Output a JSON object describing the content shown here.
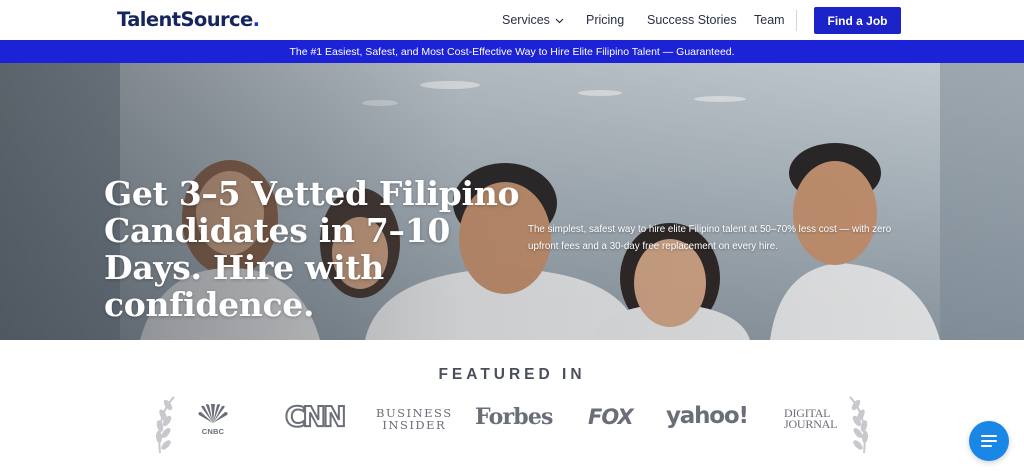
{
  "header": {
    "logo_text": "TalentSource",
    "logo_dot": ".",
    "nav": [
      {
        "label": "Services",
        "has_dropdown": true
      },
      {
        "label": "Pricing"
      },
      {
        "label": "Success Stories"
      },
      {
        "label": "Team"
      }
    ],
    "cta_label": "Find a Job"
  },
  "banner": {
    "text": "The #1 Easiest, Safest, and Most Cost-Effective Way to Hire Elite Filipino Talent — Guaranteed."
  },
  "hero": {
    "title": "Get 3–5 Vetted Filipino Candidates in 7–10 Days. Hire with confidence.",
    "subtitle": "The simplest, safest way to hire elite Filipino talent at 50–70% less cost — with zero upfront fees and a 30-day free replacement on every hire."
  },
  "featured": {
    "heading": "FEATURED IN",
    "logos": {
      "nbc": "CNBC",
      "cnn": "CNN",
      "business_insider_line1": "BUSINESS",
      "business_insider_line2": "INSIDER",
      "forbes": "Forbes",
      "fox": "FOX",
      "yahoo": "yahoo!",
      "digital_journal_line1": "DIGITAL",
      "digital_journal_line2": "JOURNAL"
    }
  },
  "colors": {
    "brand_navy": "#16255e",
    "brand_blue": "#1b22c8",
    "banner_blue": "#1c22d6",
    "chat_blue": "#1a86e6",
    "logo_gray": "#6a6e78"
  },
  "icons": {
    "services_chevron": "chevron-down-icon",
    "chat": "chat-menu-icon",
    "laurel": "laurel-wreath-icon",
    "nbc_peacock": "peacock-icon"
  }
}
